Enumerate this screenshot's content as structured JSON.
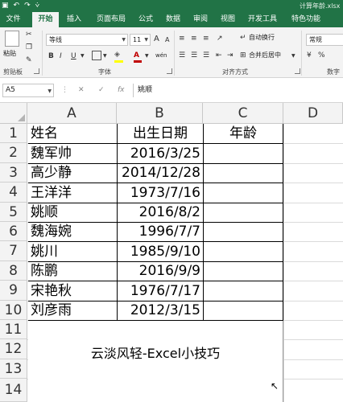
{
  "titlebar": {
    "doc_title": "计算年龄.xlsx",
    "qat_save": "▣",
    "qat_undo": "↶",
    "qat_redo": "↷",
    "qat_more": "⩒"
  },
  "tabs": [
    "文件",
    "开始",
    "插入",
    "页面布局",
    "公式",
    "数据",
    "审阅",
    "视图",
    "开发工具",
    "特色功能"
  ],
  "ribbon": {
    "paste_label": "粘贴",
    "clipboard_label": "剪贴板",
    "font_name": "等线",
    "font_size": "11",
    "grow_font": "A",
    "shrink_font": "A",
    "bold": "B",
    "italic": "I",
    "underline": "U",
    "font_color_glyph": "A",
    "wen": "wén",
    "font_label": "字体",
    "wrap_text": "自动换行",
    "merge_center": "合并后居中",
    "align_label": "对齐方式",
    "number_format": "常规",
    "number_label": "数字"
  },
  "formula_bar": {
    "name_box": "A5",
    "cancel": "✕",
    "enter": "✓",
    "fx": "fx",
    "value": "姚顺"
  },
  "columns": [
    "A",
    "B",
    "C",
    "D"
  ],
  "rows": [
    "1",
    "2",
    "3",
    "4",
    "5",
    "6",
    "7",
    "8",
    "9",
    "10",
    "11",
    "12",
    "13",
    "14"
  ],
  "table": {
    "headers": [
      "姓名",
      "出生日期",
      "年龄"
    ],
    "records": [
      [
        "魏军帅",
        "2016/3/25"
      ],
      [
        "高少静",
        "2014/12/28"
      ],
      [
        "王洋洋",
        "1973/7/16"
      ],
      [
        "姚顺",
        "2016/8/2"
      ],
      [
        "魏海婉",
        "1996/7/7"
      ],
      [
        "姚川",
        "1985/9/10"
      ],
      [
        "陈鹏",
        "2016/9/9"
      ],
      [
        "宋艳秋",
        "1976/7/17"
      ],
      [
        "刘彦雨",
        "2012/3/15"
      ]
    ]
  },
  "caption": "云淡风轻-Excel小技巧",
  "colors": {
    "excel_green": "#217346",
    "ribbon_bg": "#f3f3f3",
    "header_bg": "#f3f3f3",
    "gridline": "#dadada"
  }
}
